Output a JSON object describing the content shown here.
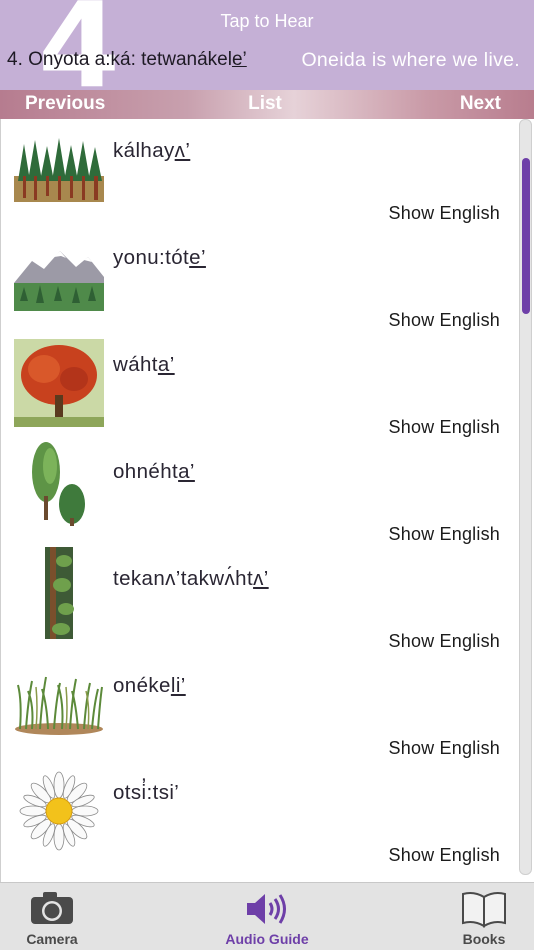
{
  "header": {
    "lesson_number": "4",
    "tap_label": "Tap to Hear",
    "phrase_native_prefix": "4. Onyota a:ká: tetwanákel",
    "phrase_native_underlined": "e’",
    "phrase_english": "Oneida is where we live."
  },
  "nav": {
    "previous": "Previous",
    "list": "List",
    "next": "Next"
  },
  "items": [
    {
      "word_prefix": "kálhay",
      "word_ul": "ʌ’",
      "show_english": "Show English",
      "icon": "forest-icon"
    },
    {
      "word_prefix": "yonu:tót",
      "word_ul": "e’",
      "show_english": "Show English",
      "icon": "mountain-icon"
    },
    {
      "word_prefix": "wáht",
      "word_ul": "a’",
      "show_english": "Show English",
      "icon": "maple-tree-icon"
    },
    {
      "word_prefix": "ohnéht",
      "word_ul": "a’",
      "show_english": "Show English",
      "icon": "pine-trees-icon"
    },
    {
      "word_prefix": "tekanʌ’takwʌ́ht",
      "word_ul": "ʌ’",
      "show_english": "Show English",
      "icon": "tall-tree-icon"
    },
    {
      "word_prefix": "onéke",
      "word_ul": "li’",
      "show_english": "Show English",
      "icon": "grass-icon"
    },
    {
      "word_prefix": "otsi̓:tsi’",
      "word_ul": "",
      "show_english": "Show English",
      "icon": "daisy-icon"
    }
  ],
  "tabs": {
    "camera": "Camera",
    "audio_guide": "Audio Guide",
    "books": "Books"
  },
  "colors": {
    "header_bg": "#c5b0d6",
    "accent": "#6e3fa8",
    "nav_bar": "#b67c8f"
  }
}
